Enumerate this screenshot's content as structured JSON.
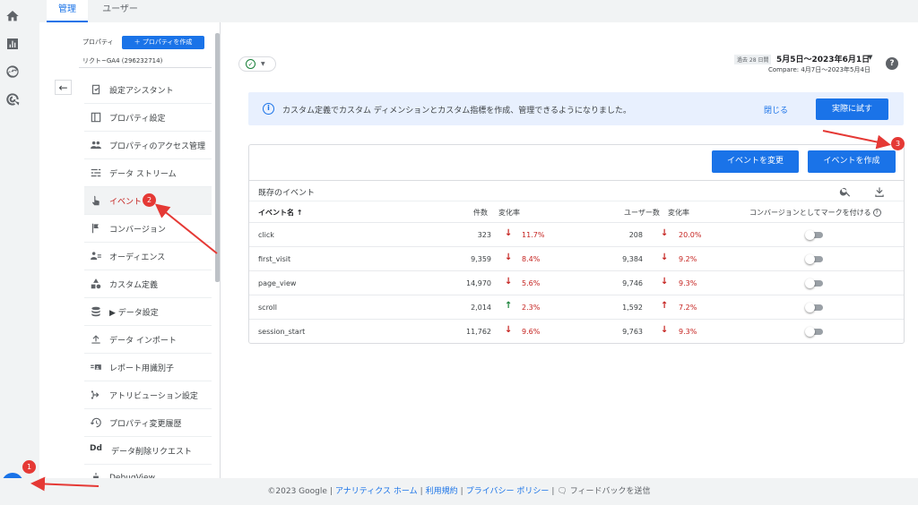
{
  "tabs": {
    "admin": "管理",
    "user": "ユーザー"
  },
  "left_panel": {
    "property_label": "プロパティ",
    "create_property": "＋ プロパティを作成",
    "property_name": "リクト~GA4 (296232714)",
    "back_icon": "arrow-left-icon",
    "items": [
      {
        "label": "設定アシスタント",
        "icon": "checklist-icon"
      },
      {
        "label": "プロパティ設定",
        "icon": "property-icon"
      },
      {
        "label": "プロパティのアクセス管理",
        "icon": "people-icon"
      },
      {
        "label": "データ ストリーム",
        "icon": "stream-icon"
      },
      {
        "label": "イベント",
        "icon": "touch-icon"
      },
      {
        "label": "コンバージョン",
        "icon": "flag-icon"
      },
      {
        "label": "オーディエンス",
        "icon": "audience-icon"
      },
      {
        "label": "カスタム定義",
        "icon": "shapes-icon"
      },
      {
        "label": "▶ データ設定",
        "icon": "database-icon"
      },
      {
        "label": "データ インポート",
        "icon": "upload-icon"
      },
      {
        "label": "レポート用識別子",
        "icon": "identity-icon"
      },
      {
        "label": "アトリビューション設定",
        "icon": "attribution-icon"
      },
      {
        "label": "プロパティ変更履歴",
        "icon": "history-icon"
      },
      {
        "label": "データ削除リクエスト",
        "icon": "dd-icon"
      },
      {
        "label": "DebugView",
        "icon": "debug-icon"
      }
    ]
  },
  "header": {
    "date_tag": "過去 28 日間",
    "date_range": "5月5日～2023年6月1日",
    "compare": "Compare: 4月7日～2023年5月4日"
  },
  "banner": {
    "message": "カスタム定義でカスタム ディメンションとカスタム指標を作成、管理できるようになりました。",
    "close": "閉じる",
    "try": "実際に試す"
  },
  "card": {
    "modify_button": "イベントを変更",
    "create_button": "イベントを作成",
    "title": "既存のイベント",
    "columns": {
      "event_name": "イベント名 ↑",
      "count": "件数",
      "change1": "変化率",
      "users": "ユーザー数",
      "change2": "変化率",
      "mark_conversion": "コンバージョンとしてマークを付ける"
    },
    "rows": [
      {
        "name": "click",
        "count": "323",
        "count_dir": "down",
        "count_change": "11.7%",
        "users": "208",
        "users_dir": "down",
        "users_change": "20.0%",
        "conversion": false
      },
      {
        "name": "first_visit",
        "count": "9,359",
        "count_dir": "down",
        "count_change": "8.4%",
        "users": "9,384",
        "users_dir": "down",
        "users_change": "9.2%",
        "conversion": false
      },
      {
        "name": "page_view",
        "count": "14,970",
        "count_dir": "down",
        "count_change": "5.6%",
        "users": "9,746",
        "users_dir": "down",
        "users_change": "9.3%",
        "conversion": false
      },
      {
        "name": "scroll",
        "count": "2,014",
        "count_dir": "up",
        "count_change": "2.3%",
        "users": "1,592",
        "users_dir": "up",
        "users_change": "7.2%",
        "conversion": false
      },
      {
        "name": "session_start",
        "count": "11,762",
        "count_dir": "down",
        "count_change": "9.6%",
        "users": "9,763",
        "users_dir": "down",
        "users_change": "9.3%",
        "conversion": false
      }
    ]
  },
  "footer": {
    "copyright": "©2023 Google",
    "analytics_home": "アナリティクス ホーム",
    "terms": "利用規約",
    "privacy": "プライバシー ポリシー",
    "feedback": "フィードバックを送信"
  },
  "annotations": {
    "badge1": "1",
    "badge2": "2",
    "badge3": "3"
  },
  "colors": {
    "accent": "#1a73e8",
    "annotation": "#e53935",
    "down": "#c5221f",
    "up": "#188038"
  }
}
